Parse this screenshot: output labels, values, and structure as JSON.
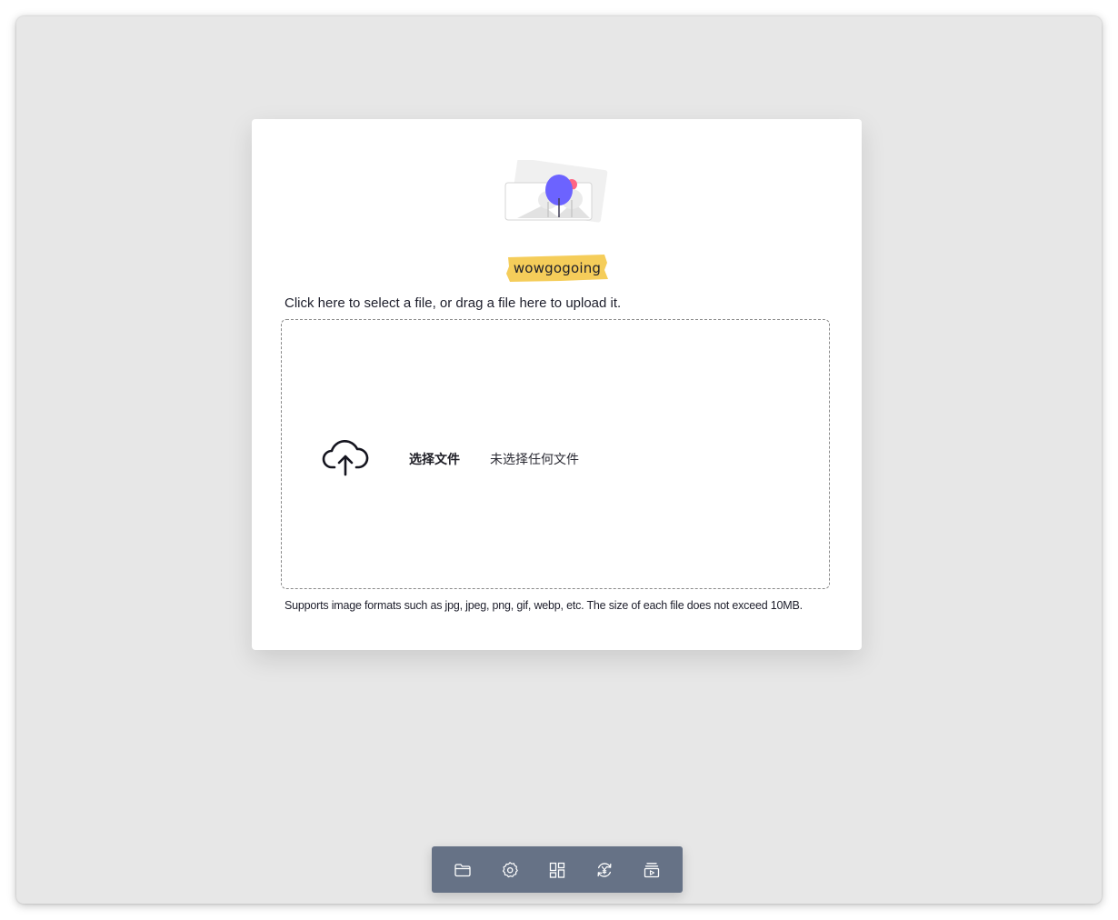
{
  "brand": {
    "name": "wowgogoing",
    "highlight_color": "#f5cd5a"
  },
  "upload": {
    "instruction": "Click here to select a file, or drag a file here to upload it.",
    "choose_button_label": "选择文件",
    "no_file_status": "未选择任何文件",
    "hint": "Supports image formats such as jpg, jpeg, png, gif, webp, etc. The size of each file does not exceed 10MB.",
    "icon": "cloud-upload-icon"
  },
  "toolbar": {
    "background_color": "#667286",
    "items": [
      {
        "icon": "folder-icon"
      },
      {
        "icon": "gear-icon"
      },
      {
        "icon": "grid-layout-icon"
      },
      {
        "icon": "yen-refresh-icon"
      },
      {
        "icon": "playlist-icon"
      }
    ]
  },
  "colors": {
    "window_background": "#e7e7e7",
    "card_background": "#ffffff",
    "illustration_accent": "#6c63ff",
    "illustration_secondary": "#ff6584"
  }
}
